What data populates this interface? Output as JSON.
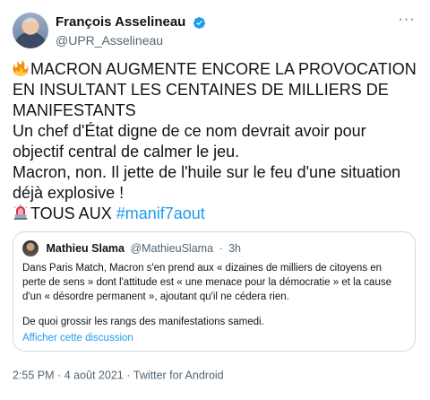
{
  "author": {
    "display_name": "François Asselineau",
    "handle": "@UPR_Asselineau",
    "verified_icon": "verified-badge-icon"
  },
  "more_icon": "more-options-icon",
  "tweet": {
    "fire_emoji": "fire-emoji-icon",
    "headline": "MACRON AUGMENTE ENCORE LA PROVOCATION EN INSULTANT LES CENTAINES DE MILLIERS DE MANIFESTANTS",
    "line1": "Un chef d'État digne de ce nom devrait avoir pour objectif central de calmer le jeu.",
    "line2": "Macron, non. Il jette de l'huile sur le feu d'une situation déjà explosive !",
    "siren_emoji": "police-light-emoji-icon",
    "call_text": "TOUS AUX ",
    "hashtag": "#manif7aout"
  },
  "quote": {
    "name": "Mathieu Slama",
    "handle": "@MathieuSlama",
    "sep": "·",
    "time": "3h",
    "paragraph1": "Dans Paris Match, Macron s'en prend  aux « dizaines de milliers de citoyens en perte de sens » dont l'attitude est « une menace pour la démocratie » et la cause d'un « désordre permanent », ajoutant qu'il ne cédera rien.",
    "paragraph2": "De quoi grossir les rangs des manifestations samedi.",
    "show_thread": "Afficher cette discussion"
  },
  "meta": {
    "time": "2:55 PM",
    "sep1": "·",
    "date": "4 août 2021",
    "sep2": "·",
    "source": "Twitter for Android"
  },
  "colors": {
    "link": "#1d9bf0",
    "secondary_text": "#536471",
    "border": "#cfd9de",
    "verified": "#1d9bf0"
  }
}
